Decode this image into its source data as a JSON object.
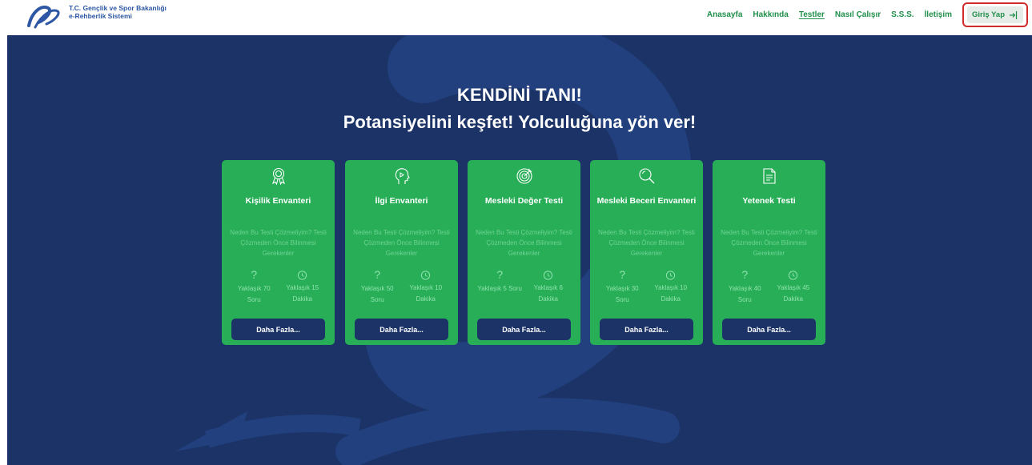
{
  "header": {
    "brand_line1": "T.C. Gençlik ve Spor Bakanlığı",
    "brand_line2": "e-Rehberlik Sistemi",
    "nav": [
      {
        "label": "Anasayfa",
        "active": false
      },
      {
        "label": "Hakkında",
        "active": false
      },
      {
        "label": "Testler",
        "active": true
      },
      {
        "label": "Nasıl Çalışır",
        "active": false
      },
      {
        "label": "S.S.S.",
        "active": false
      },
      {
        "label": "İletişim",
        "active": false
      }
    ],
    "login_label": "Giriş Yap"
  },
  "hero": {
    "title": "KENDİNİ TANI!",
    "subtitle": "Potansiyelini keşfet! Yolculuğuna yön ver!"
  },
  "cards": [
    {
      "icon": "award-icon",
      "title": "Kişilik Envanteri",
      "desc": "Neden Bu Testi Çözmeliyim? Testi Çözmeden Önce Bilinmesi Gerekenler",
      "q_label": "Yaklaşık 70 Soru",
      "t_label": "Yaklaşık 15 Dakika",
      "button": "Daha Fazla..."
    },
    {
      "icon": "head-icon",
      "title": "İlgi Envanteri",
      "desc": "Neden Bu Testi Çözmeliyim? Testi Çözmeden Önce Bilinmesi Gerekenler",
      "q_label": "Yaklaşık 50 Soru",
      "t_label": "Yaklaşık 10 Dakika",
      "button": "Daha Fazla..."
    },
    {
      "icon": "target-icon",
      "title": "Mesleki Değer Testi",
      "desc": "Neden Bu Testi Çözmeliyim? Testi Çözmeden Önce Bilinmesi Gerekenler",
      "q_label": "Yaklaşık 5 Soru",
      "t_label": "Yaklaşık 6 Dakika",
      "button": "Daha Fazla..."
    },
    {
      "icon": "search-icon",
      "title": "Mesleki Beceri Envanteri",
      "desc": "Neden Bu Testi Çözmeliyim? Testi Çözmeden Önce Bilinmesi Gerekenler",
      "q_label": "Yaklaşık 30 Soru",
      "t_label": "Yaklaşık 10 Dakika",
      "button": "Daha Fazla..."
    },
    {
      "icon": "document-icon",
      "title": "Yetenek Testi",
      "desc": "Neden Bu Testi Çözmeliyim? Testi Çözmeden Önce Bilinmesi Gerekenler",
      "q_label": "Yaklaşık 40 Soru",
      "t_label": "Yaklaşık 45 Dakika",
      "button": "Daha Fazla..."
    }
  ],
  "colors": {
    "brand_green": "#27ae57",
    "nav_green": "#1f8f4a",
    "hero_navy": "#1b3367",
    "highlight_red": "#d02b2b"
  }
}
